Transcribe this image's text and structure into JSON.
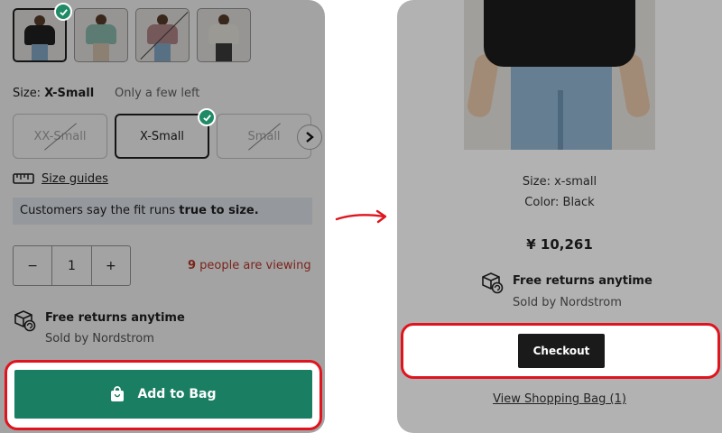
{
  "left": {
    "thumbnails": [
      {
        "top_color": "#222222",
        "selected": true,
        "unavailable": false
      },
      {
        "top_color": "#8fc0b4",
        "selected": false,
        "unavailable": false
      },
      {
        "top_color": "#b78a8d",
        "selected": false,
        "unavailable": true
      },
      {
        "top_color": "#f1efe6",
        "selected": false,
        "unavailable": true
      }
    ],
    "size_prefix": "Size: ",
    "size_value": "X-Small",
    "stock_note": "Only a few left",
    "size_options": [
      {
        "label": "XX-Small",
        "available": false,
        "selected": false
      },
      {
        "label": "X-Small",
        "available": true,
        "selected": true
      },
      {
        "label": "Small",
        "available": false,
        "selected": false
      }
    ],
    "size_guides_label": "Size guides",
    "fit_note_prefix": "Customers say the fit runs ",
    "fit_note_bold": "true to size.",
    "quantity": {
      "minus": "−",
      "value": "1",
      "plus": "+"
    },
    "viewing_count": "9",
    "viewing_text": " people are viewing",
    "returns_title": "Free returns anytime",
    "sold_by": "Sold by Nordstrom",
    "add_to_bag_label": "Add to Bag"
  },
  "right": {
    "size_text": "Size: x-small",
    "color_text": "Color: Black",
    "price": "¥ 10,261",
    "returns_title": "Free returns anytime",
    "sold_by": "Sold by Nordstrom",
    "checkout_label": "Checkout",
    "view_bag_label": "View Shopping Bag (1)"
  },
  "colors": {
    "accent_green": "#1a7e62",
    "check_green": "#1e8a66",
    "highlight_red": "#e0141e",
    "viewing_red": "#c0392b",
    "checkout_black": "#1a1a1a"
  },
  "icons": {
    "selected_check": "check-icon",
    "next": "chevron-right-icon",
    "size_guides": "ruler-icon",
    "returns": "return-box-icon",
    "bag": "shopping-bag-icon",
    "transition": "arrow-right-icon"
  }
}
